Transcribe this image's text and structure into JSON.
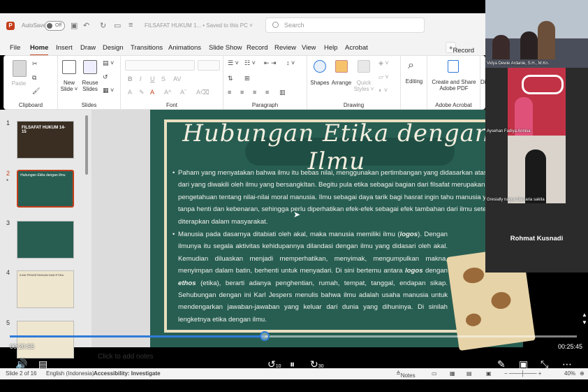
{
  "titlebar": {
    "autosave_label": "AutoSave",
    "autosave_state": "Off",
    "document_title": "FILSAFAT HUKUM 1... • Saved to this PC ˅",
    "search_placeholder": "Search"
  },
  "menu": {
    "items": [
      "File",
      "Home",
      "Insert",
      "Draw",
      "Design",
      "Transitions",
      "Animations",
      "Slide Show",
      "Record",
      "Review",
      "View",
      "Help",
      "Acrobat"
    ],
    "active": "Home",
    "record_button": "Record"
  },
  "ribbon": {
    "clipboard": {
      "label": "Clipboard",
      "paste": "Paste"
    },
    "slides": {
      "label": "Slides",
      "new_slide": "New Slide ˅",
      "reuse_slides": "Reuse Slides"
    },
    "font": {
      "label": "Font"
    },
    "paragraph": {
      "label": "Paragraph"
    },
    "drawing": {
      "label": "Drawing",
      "shapes": "Shapes",
      "arrange": "Arrange",
      "quick_styles": "Quick Styles ˅"
    },
    "editing": {
      "label": "Editing"
    },
    "acrobat": {
      "label": "Adobe Acrobat",
      "create_share": "Create and Share Adobe PDF"
    },
    "overflow_label": "Di"
  },
  "thumbnails": [
    {
      "num": "1",
      "text": "FILSAFAT HUKUM 14-15"
    },
    {
      "num": "2",
      "text": "Hubungan Etika dengan Ilmu",
      "selected": true
    },
    {
      "num": "3",
      "text": ""
    },
    {
      "num": "4",
      "text": "ILMU PENGETAHUAN DAN ETIKA"
    },
    {
      "num": "5",
      "text": ""
    }
  ],
  "slide": {
    "title": "Hubungan Etika dengan Ilmu",
    "bullet1": "Paham yang menyatakan bahwa ilmu itu bebas nilai, menggunakan pertimbangan yang didasarkan atas nilai dari yang diwakili oleh ilmu yang bersangkItan. Begitu pula etika sebagai bagian dari filsafat merupakan ilmu pengetahuan tentang nilai-nilai moral manusia. Ilmu sebagai daya tarik bagi hasrat ingin tahu manusia yang tanpa henti dan kebenaran, sehingga perlu diperhatikan efek-efek sebagai efek tambahan dari ilmu setelah diterapkan dalam masyarakat.",
    "bullet2_a": "Manusia pada dasarnya ditabiati oleh akal, maka manusia memiliki ilmu (",
    "bullet2_logos": "logos",
    "bullet2_b": "). Dengan ilmunya itu segala aktivitas kehidupannya dilandasi dengan ilmu yang didasari oleh akal. Kemudian diluaskan menjadi memperhatikan, menyimak, mengumpulkan makna, menyimpan dalam batin, berhenti untuk menyadari. Di sini bertemu antara ",
    "bullet2_logos2": "logos",
    "bullet2_c": " dengan ",
    "bullet2_ethos": "ethos",
    "bullet2_d": " (etika), berarti adanya penghentian, rumah, tempat, tanggal, endapan sikap. Sehubungan dengan ini Karl Jespers menulis bahwa ilmu adalah usaha manusia untuk mendengarkan jawaban-jawaban yang keluar dari dunia yang dihuninya. Di sinilah lengketnya etika dengan ilmu."
  },
  "notes_placeholder": "Click to add notes",
  "player": {
    "current_time": "00:20:55",
    "total_time": "00:25:45",
    "progress": 0.45,
    "skip_back": "10",
    "skip_forward": "30"
  },
  "status": {
    "slide_of": "Slide 2 of 16",
    "language": "English (Indonesia)",
    "accessibility": "Accessibility: Investigate",
    "notes": "Notes",
    "zoom": "40%"
  },
  "participants": [
    {
      "name": "Vidya Dewie Ardanie, S.H., M.Kn."
    },
    {
      "name": "Aysehan Fadiya Annisa"
    },
    {
      "name": "Gresially nayya Damaria sakita"
    },
    {
      "name": "Rohmat Kusnadi"
    }
  ],
  "colors": {
    "accent": "#c43e1c",
    "slide_bg": "#285e52",
    "progress": "#2f7bd8"
  }
}
